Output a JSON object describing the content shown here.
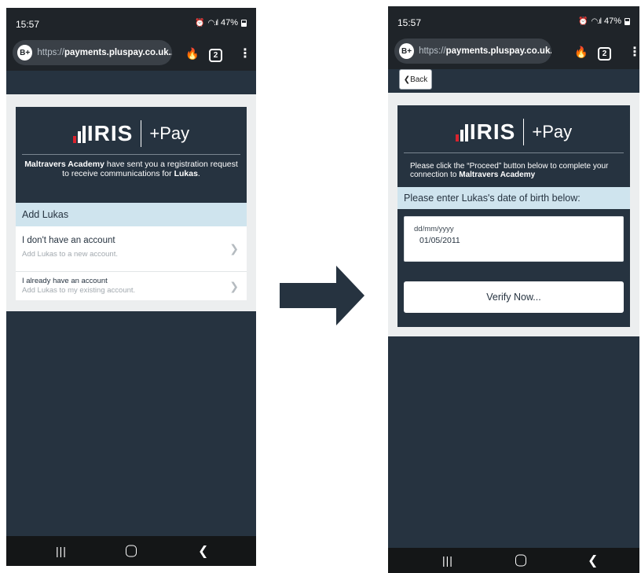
{
  "status_bar": {
    "time": "15:57",
    "battery": "47%"
  },
  "browser": {
    "url_prefix": "https://",
    "url_domain": "payments.pluspay.co.uk...",
    "url_domain_alt": "payments.pluspay.co.uk...",
    "badge": "B+",
    "tab_count": "2"
  },
  "logo": {
    "brand": "IRIS",
    "product": "+Pay"
  },
  "screen1": {
    "school": "Maltravers Academy",
    "msg_after_school": " have sent you a registration request to receive communications for ",
    "child": "Lukas",
    "period": ".",
    "section": "Add Lukas",
    "option1": {
      "title": "I don't have an account",
      "subtitle": "Add Lukas to a new account."
    },
    "option2": {
      "title": "I already have an account",
      "subtitle": "Add Lukas to my existing account."
    }
  },
  "screen2": {
    "back_label": "Back",
    "proceed_text": "Please click the “Proceed” button below to complete your connection to ",
    "school": "Maltravers Academy",
    "section": "Please enter Lukas's date of birth below:",
    "dob_placeholder": "dd/mm/yyyy",
    "dob_value": "01/05/2011",
    "verify_label": "Verify Now..."
  },
  "icons": {
    "flame": "flame-icon",
    "chevron": "chevron-right-icon",
    "arrow": "arrow-right-icon"
  },
  "colors": {
    "dark_navy": "#263340",
    "light_panel": "#eceeef",
    "section_blue": "#cfe4ee",
    "brand_red": "#d9232e"
  }
}
